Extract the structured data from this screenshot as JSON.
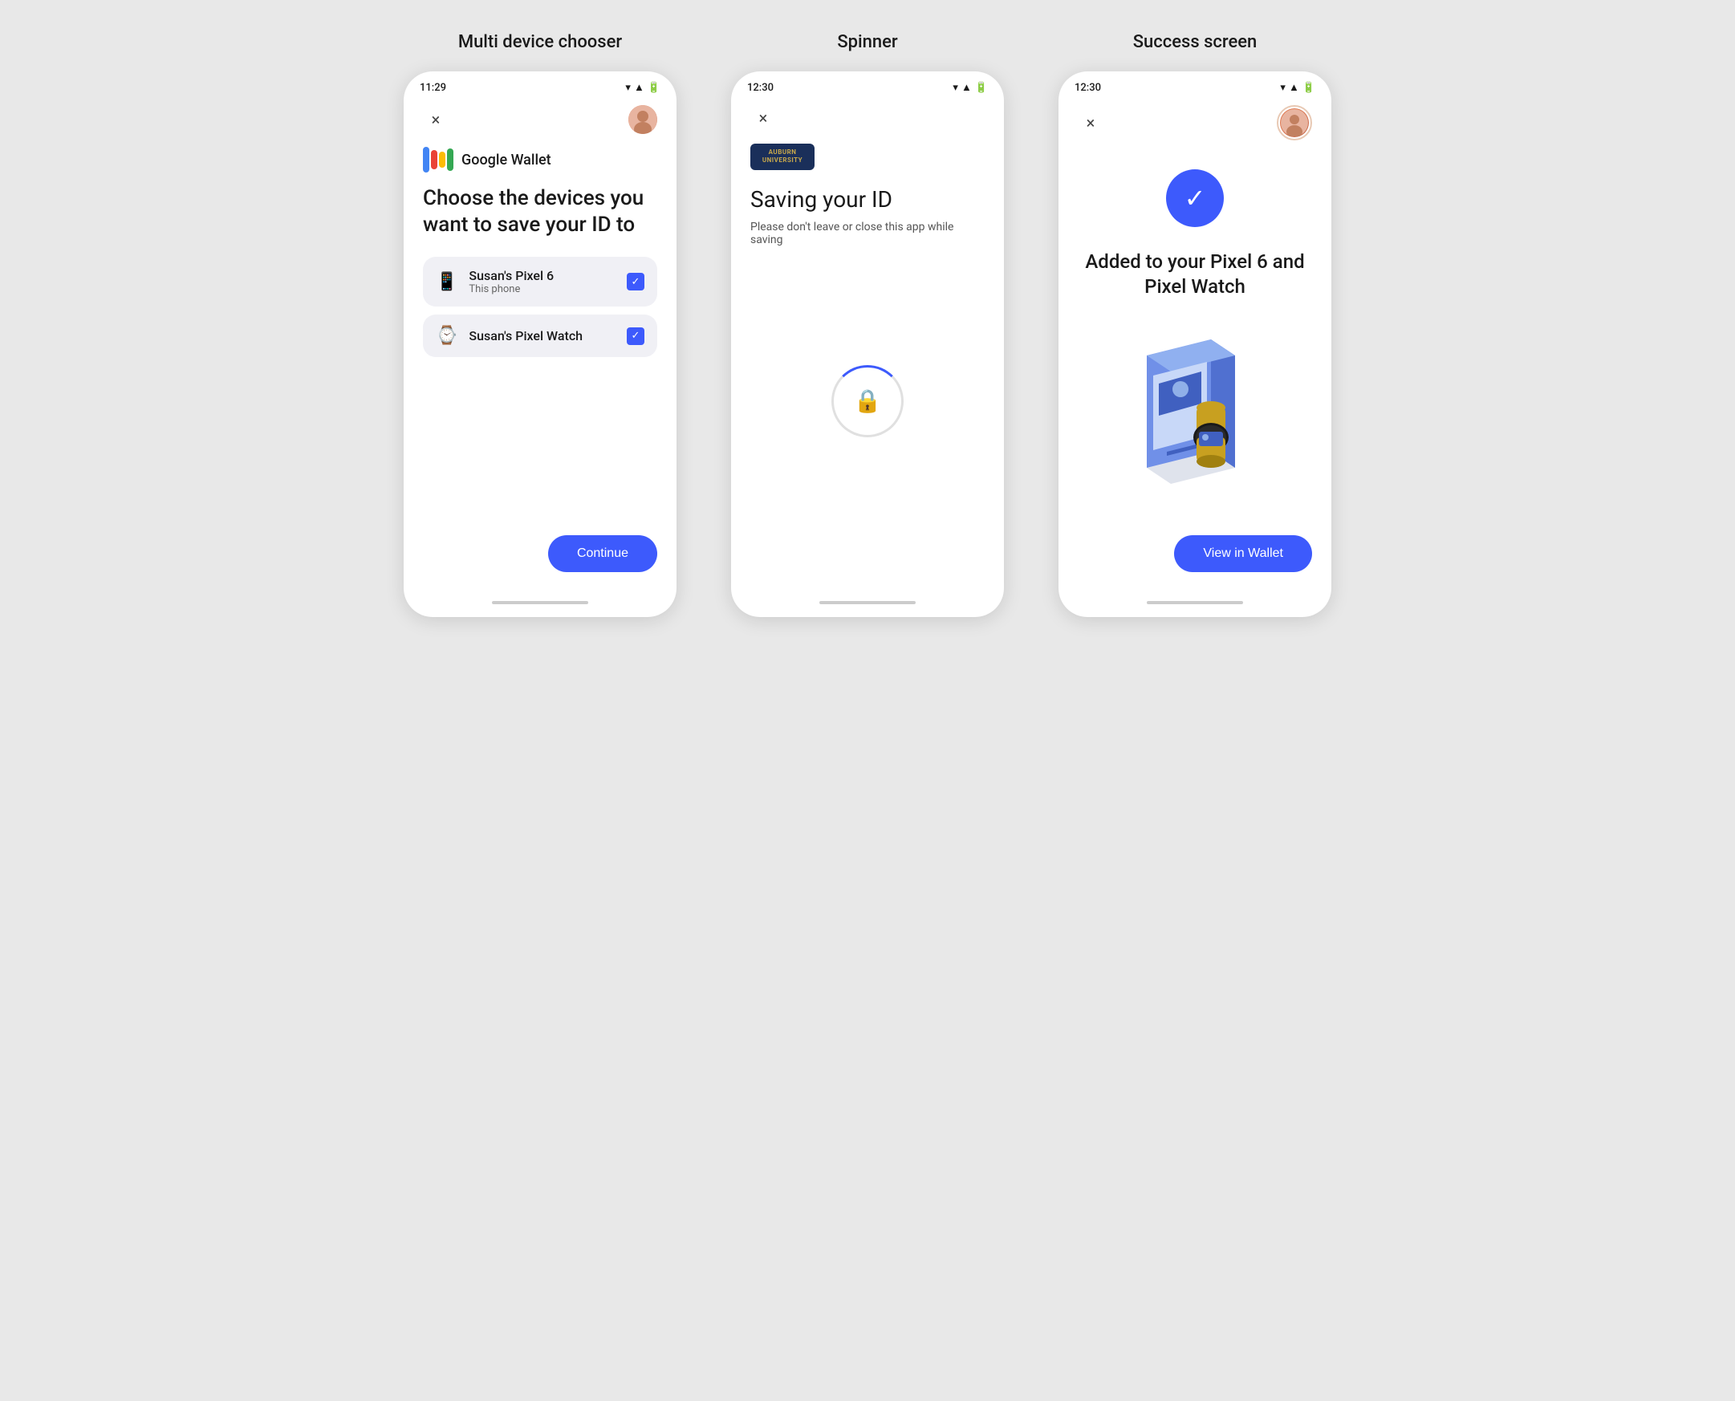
{
  "background": "#e8e8e8",
  "screens": {
    "multi_device": {
      "title": "Multi device chooser",
      "status_time": "11:29",
      "close_label": "×",
      "wallet_name": "Google Wallet",
      "heading": "Choose the devices you want to save your ID to",
      "devices": [
        {
          "name": "Susan's Pixel 6",
          "subtitle": "This phone",
          "icon": "📱",
          "checked": true
        },
        {
          "name": "Susan's Pixel Watch",
          "subtitle": "",
          "icon": "⌚",
          "checked": true
        }
      ],
      "continue_label": "Continue"
    },
    "spinner": {
      "title": "Spinner",
      "status_time": "12:30",
      "close_label": "×",
      "university_badge": "AUBURN\nUNIVERSITY",
      "heading": "Saving your ID",
      "subtext": "Please don't leave or close this app while saving"
    },
    "success": {
      "title": "Success screen",
      "status_time": "12:30",
      "close_label": "×",
      "check_icon": "✓",
      "heading": "Added to your Pixel 6 and Pixel Watch",
      "view_wallet_label": "View in Wallet"
    }
  },
  "colors": {
    "accent": "#3d5afc",
    "bg_white": "#ffffff",
    "device_bg": "#f0f0f5",
    "text_dark": "#1a1a1a",
    "text_muted": "#555555",
    "auburn_navy": "#1a2f5a",
    "auburn_gold": "#c8a84b"
  }
}
